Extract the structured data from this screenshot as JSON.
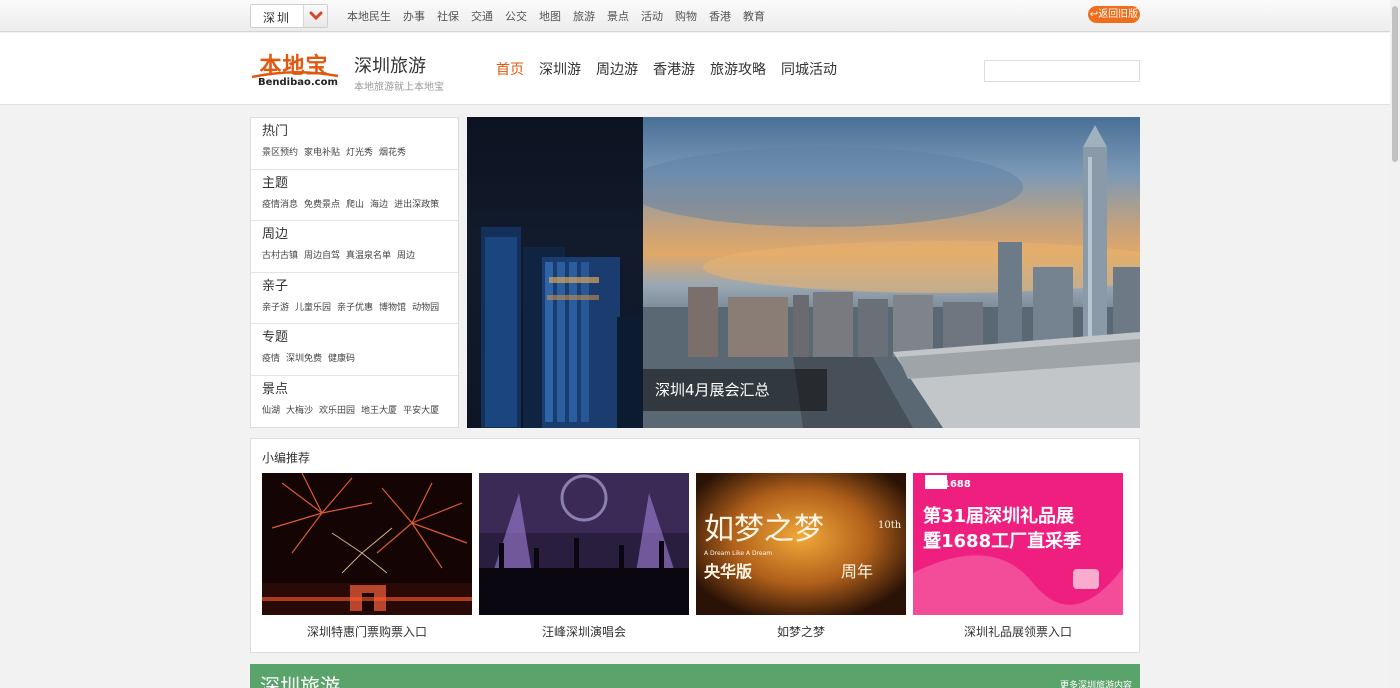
{
  "topbar": {
    "city": "深圳",
    "nav": [
      "本地民生",
      "办事",
      "社保",
      "交通",
      "公交",
      "地图",
      "旅游",
      "景点",
      "活动",
      "购物",
      "香港",
      "教育"
    ],
    "old_version": "返回旧版"
  },
  "header": {
    "logo_cn": "本地宝",
    "logo_en": "Bendibao.com",
    "site_title": "深圳旅游",
    "slogan": "本地旅游就上本地宝",
    "nav": [
      {
        "label": "首页",
        "active": true
      },
      {
        "label": "深圳游",
        "active": false
      },
      {
        "label": "周边游",
        "active": false
      },
      {
        "label": "香港游",
        "active": false
      },
      {
        "label": "旅游攻略",
        "active": false
      },
      {
        "label": "同城活动",
        "active": false
      }
    ],
    "search_placeholder": ""
  },
  "categories": [
    {
      "title": "热门",
      "links": [
        "景区预约",
        "家电补贴",
        "灯光秀",
        "烟花秀"
      ]
    },
    {
      "title": "主题",
      "links": [
        "疫情消息",
        "免费景点",
        "爬山",
        "海边",
        "进出深政策"
      ]
    },
    {
      "title": "周边",
      "links": [
        "古村古镇",
        "周边自驾",
        "真温泉名单",
        "周边"
      ]
    },
    {
      "title": "亲子",
      "links": [
        "亲子游",
        "儿童乐园",
        "亲子优惠",
        "博物馆",
        "动物园"
      ]
    },
    {
      "title": "专题",
      "links": [
        "疫情",
        "深圳免费",
        "健康码"
      ]
    },
    {
      "title": "景点",
      "links": [
        "仙湖",
        "大梅沙",
        "欢乐田园",
        "地王大厦",
        "平安大厦"
      ]
    }
  ],
  "hero": {
    "caption": "深圳4月展会汇总"
  },
  "recommend": {
    "title": "小编推荐",
    "items": [
      {
        "label": "深圳特惠门票购票入口"
      },
      {
        "label": "汪峰深圳演唱会"
      },
      {
        "label": "如梦之梦",
        "poster_title": "如梦之梦",
        "poster_badge": "10th",
        "poster_en": "A Dream Like A Dream",
        "poster_sub": "央华版",
        "poster_sub2": "周年"
      },
      {
        "label": "深圳礼品展领票入口",
        "poster_logo": "1688",
        "poster_line1": "第31届深圳礼品展",
        "poster_line2": "暨1688工厂直采季"
      }
    ]
  },
  "section": {
    "title": "深圳旅游",
    "more": "更多深圳旅游内容"
  },
  "colors": {
    "brand": "#e2580f",
    "section_green": "#5aa36a"
  }
}
